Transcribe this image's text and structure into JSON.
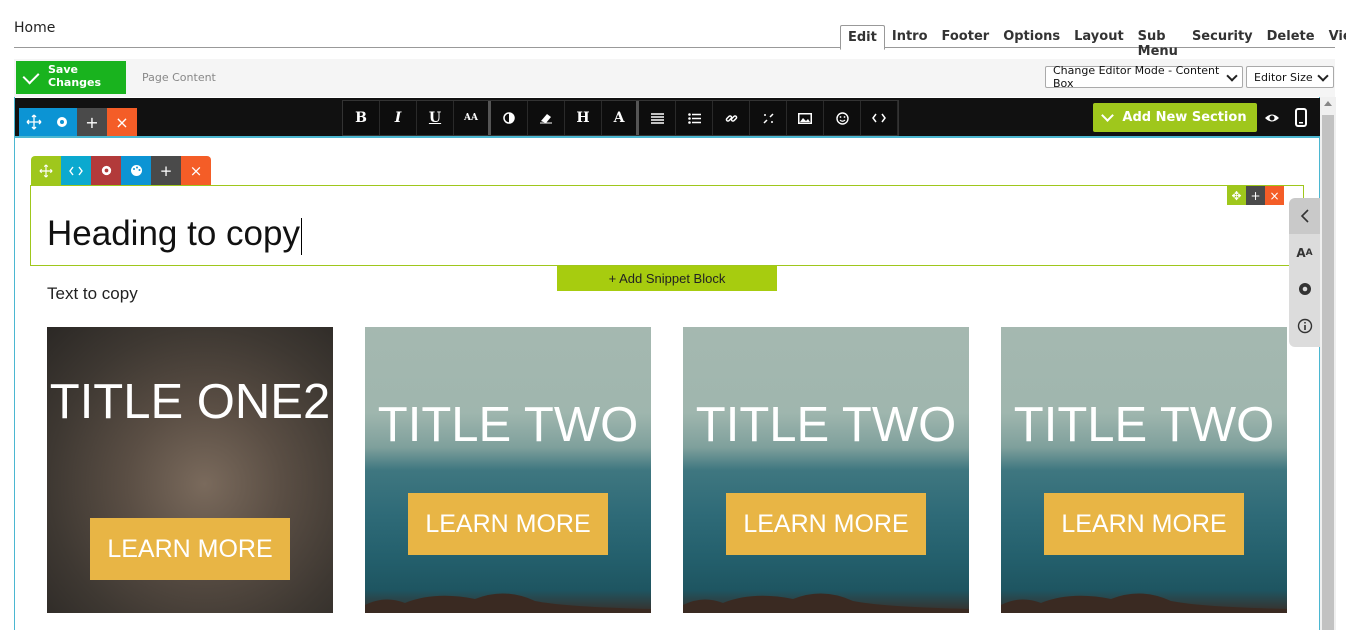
{
  "header": {
    "breadcrumb": "Home",
    "tabs": [
      "Edit",
      "Intro",
      "Footer",
      "Options",
      "Layout",
      "Sub Menu",
      "Security",
      "Delete",
      "View"
    ],
    "active_tab": "Edit"
  },
  "action_bar": {
    "save_label": "Save Changes",
    "page_content_label": "Page Content",
    "editor_mode_select": "Change Editor Mode - Content Box",
    "editor_size_select": "Editor Size"
  },
  "toolbar": {
    "format_buttons": [
      "B",
      "I",
      "U",
      "AA",
      "contrast-icon",
      "eraser-icon",
      "H",
      "A",
      "align-icon",
      "list-icon",
      "link-icon",
      "unlink-icon",
      "image-icon",
      "emoji-icon",
      "code-icon"
    ],
    "add_section_label": "Add New Section",
    "colors": {
      "green": "#9fc71c",
      "blue": "#0c94d4",
      "orange": "#f45d27",
      "dark": "#111111"
    }
  },
  "content": {
    "heading": "Heading to copy",
    "add_snippet_label": "+ Add Snippet Block",
    "text": "Text to copy",
    "cards": [
      {
        "title": "TITLE ONE2",
        "button": "LEARN MORE"
      },
      {
        "title": "TITLE TWO",
        "button": "LEARN MORE"
      },
      {
        "title": "TITLE TWO",
        "button": "LEARN MORE"
      },
      {
        "title": "TITLE TWO",
        "button": "LEARN MORE"
      }
    ],
    "button_color": "#e8b545"
  }
}
